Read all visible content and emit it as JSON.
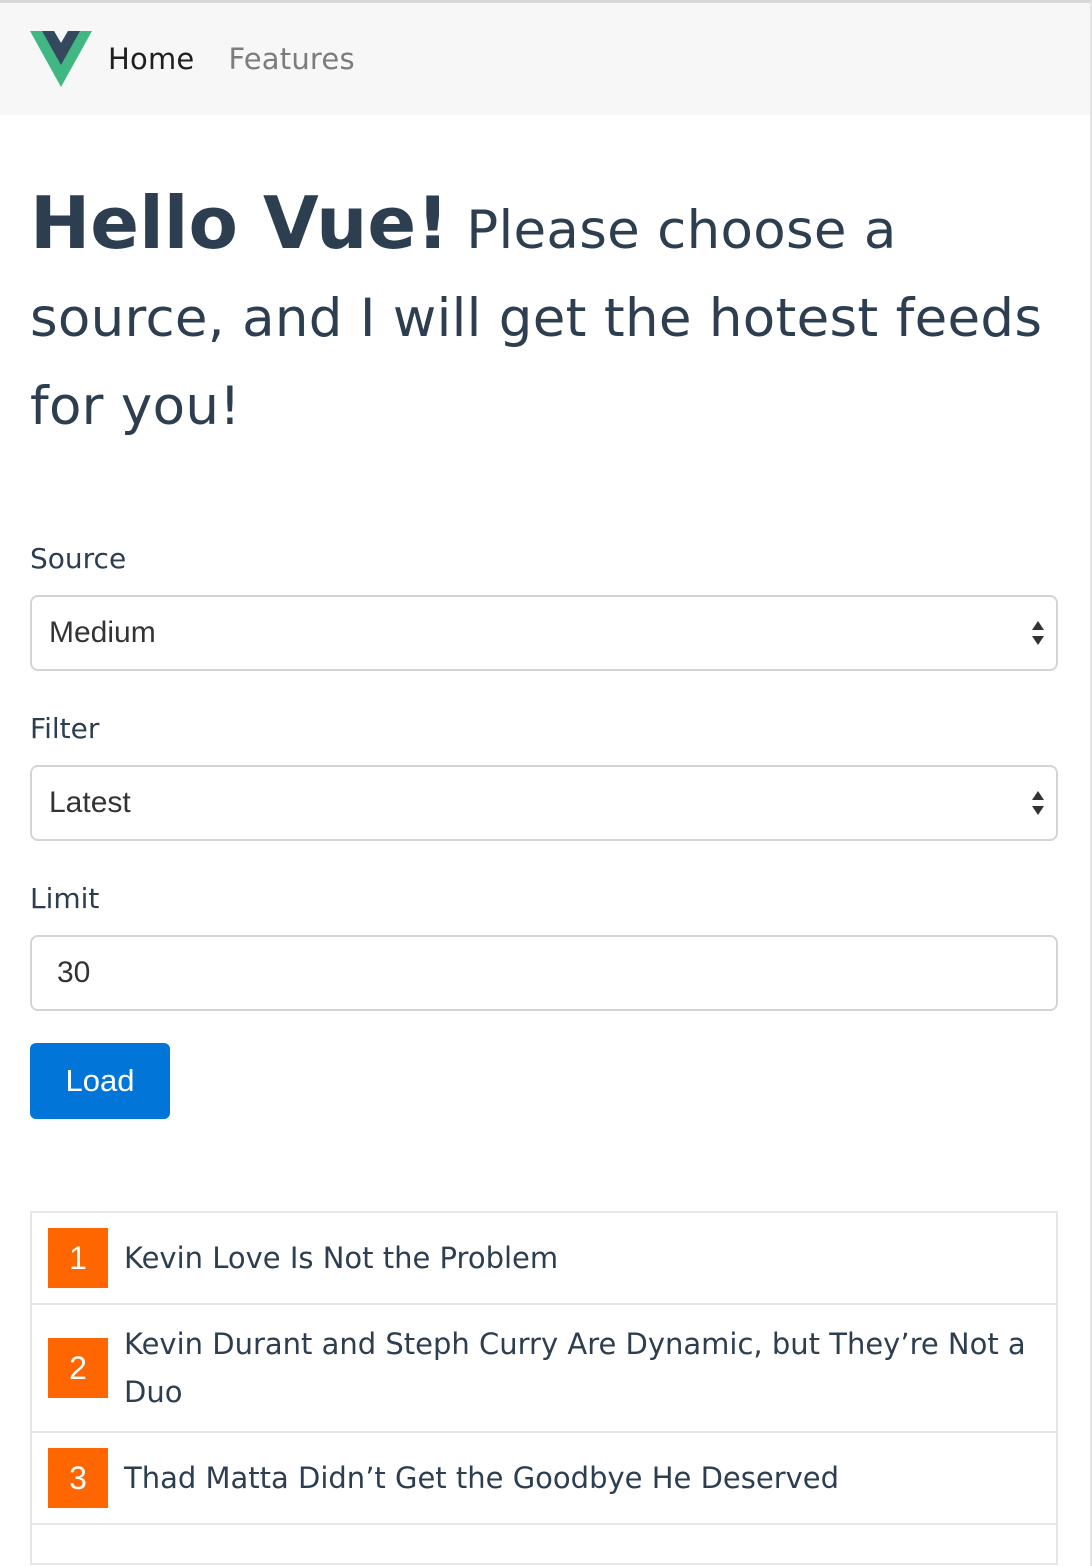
{
  "nav": {
    "logo_icon": "vue-logo-icon",
    "links": [
      {
        "label": "Home"
      },
      {
        "label": "Features"
      }
    ]
  },
  "headline": {
    "bold": "Hello Vue!",
    "rest": "Please choose a source, and I will get the hotest feeds for you!"
  },
  "form": {
    "source": {
      "label": "Source",
      "value": "Medium"
    },
    "filter": {
      "label": "Filter",
      "value": "Latest"
    },
    "limit": {
      "label": "Limit",
      "value": "30"
    },
    "load_label": "Load"
  },
  "feeds": [
    {
      "rank": "1",
      "title": "Kevin Love Is Not the Problem"
    },
    {
      "rank": "2",
      "title": "Kevin Durant and Steph Curry Are Dynamic, but They’re Not a Duo"
    },
    {
      "rank": "3",
      "title": "Thad Matta Didn’t Get the Goodbye He Deserved"
    }
  ],
  "colors": {
    "accent": "#0275d8",
    "rank_badge": "#ff6600",
    "text": "#2c3e50",
    "vue_green": "#41b883",
    "vue_dark": "#34495e"
  }
}
